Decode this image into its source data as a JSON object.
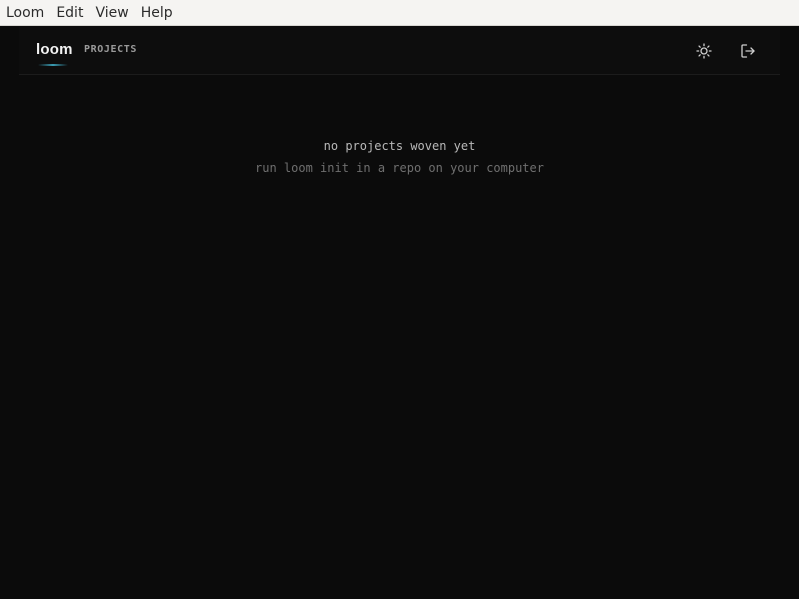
{
  "menubar": {
    "items": [
      {
        "label": "Loom"
      },
      {
        "label": "Edit"
      },
      {
        "label": "View"
      },
      {
        "label": "Help"
      }
    ]
  },
  "header": {
    "brand": "loom",
    "nav_label": "PROJECTS",
    "icons": {
      "theme": "sun-icon",
      "logout": "logout-icon"
    },
    "accent_color": "#3a9cb3"
  },
  "empty_state": {
    "title": "no projects woven yet",
    "subtitle": "run loom init in a repo on your computer"
  }
}
